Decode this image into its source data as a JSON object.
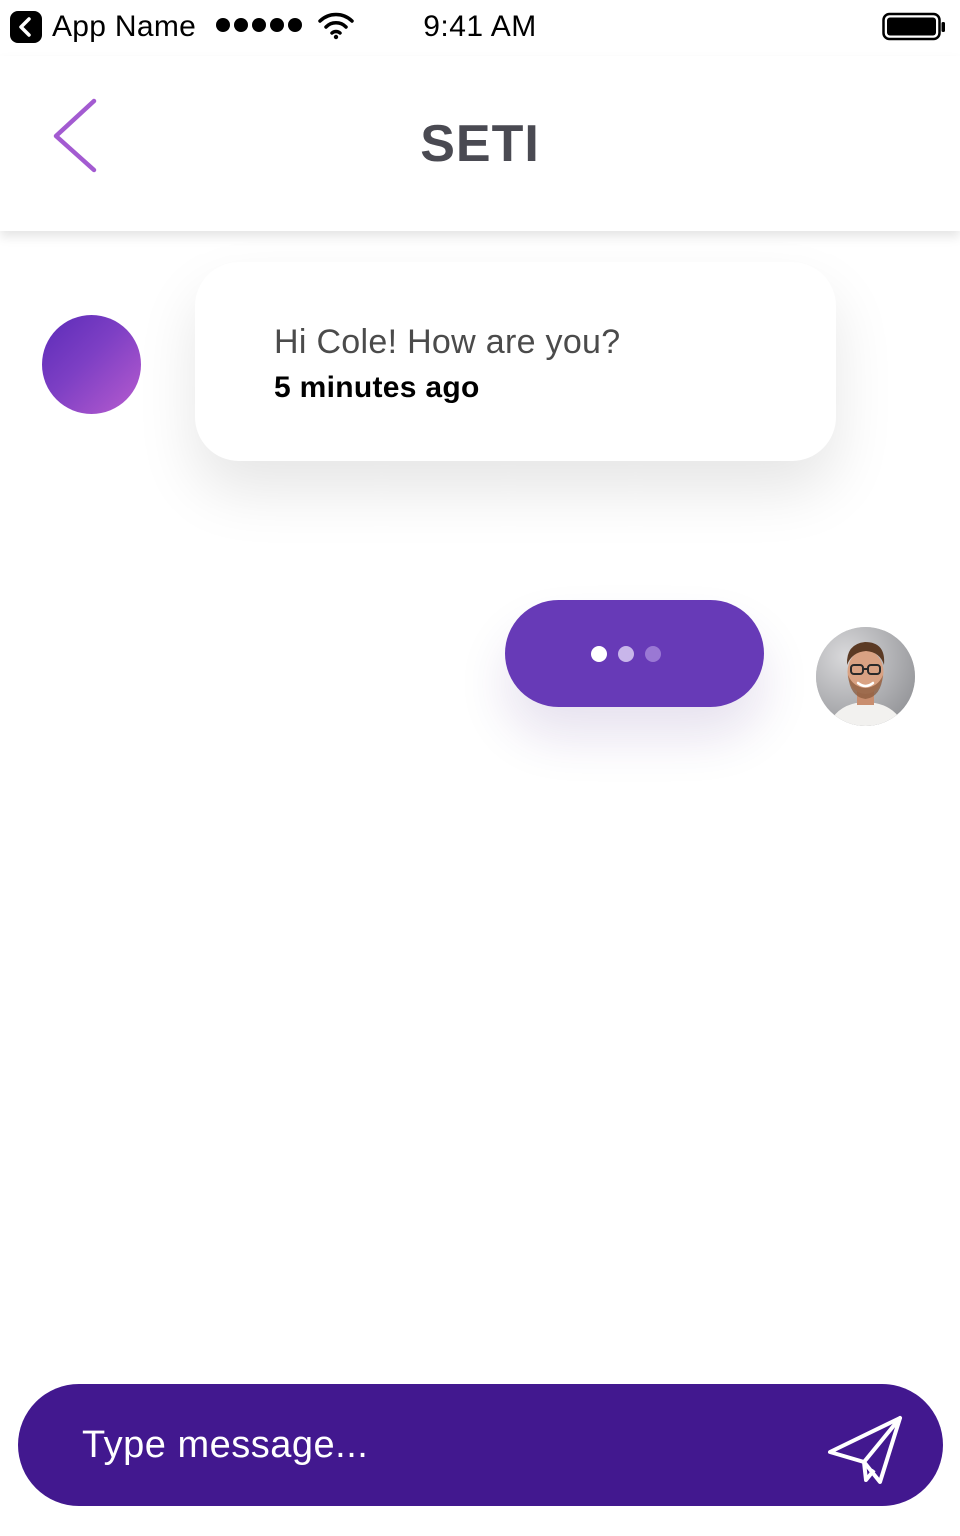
{
  "status_bar": {
    "app_name": "App Name",
    "time": "9:41 AM"
  },
  "nav": {
    "title": "SETI"
  },
  "messages": [
    {
      "from": "contact",
      "text": "Hi Cole! How are you?",
      "time": "5 minutes ago"
    },
    {
      "from": "user",
      "typing": true
    }
  ],
  "typing_indicator": {
    "dot_colors": [
      "#ffffff",
      "#c8b6ea",
      "#9a78d4"
    ]
  },
  "composer": {
    "placeholder": "Type message..."
  },
  "icons": {
    "back": "chevron-left-icon",
    "send": "paper-plane-icon"
  },
  "colors": {
    "accent": "#673ab7",
    "input_bar": "#42188f",
    "title": "#4a4a52",
    "back_chevron": "#a35bd1"
  }
}
